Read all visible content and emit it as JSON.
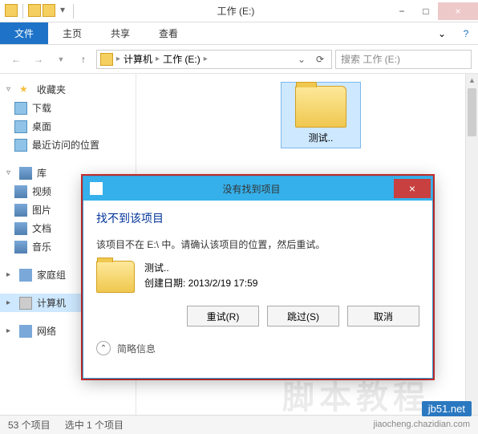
{
  "window": {
    "title": "工作 (E:)"
  },
  "ribbon": {
    "file": "文件",
    "home": "主页",
    "share": "共享",
    "view": "查看"
  },
  "breadcrumb": {
    "computer": "计算机",
    "drive": "工作 (E:)"
  },
  "search": {
    "placeholder": "搜索 工作 (E:)"
  },
  "sidebar": {
    "favorites": "收藏夹",
    "downloads": "下载",
    "desktop": "桌面",
    "recent": "最近访问的位置",
    "libraries": "库",
    "videos": "视频",
    "pictures": "图片",
    "documents": "文档",
    "music": "音乐",
    "homegroup": "家庭组",
    "computer": "计算机",
    "network": "网络"
  },
  "main": {
    "folder_name": "测试.."
  },
  "dialog": {
    "title": "没有找到项目",
    "heading": "找不到该项目",
    "message": "该项目不在 E:\\ 中。请确认该项目的位置，然后重试。",
    "file_name": "测试..",
    "created_label": "创建日期: 2013/2/19 17:59",
    "retry": "重试(R)",
    "skip": "跳过(S)",
    "cancel": "取消",
    "more": "简略信息"
  },
  "status": {
    "count": "53 个项目",
    "selected": "选中 1 个项目"
  },
  "watermark": {
    "site": "jb51.net",
    "sub": "jiaocheng.chazidian.com",
    "faint": "脚本教程"
  }
}
